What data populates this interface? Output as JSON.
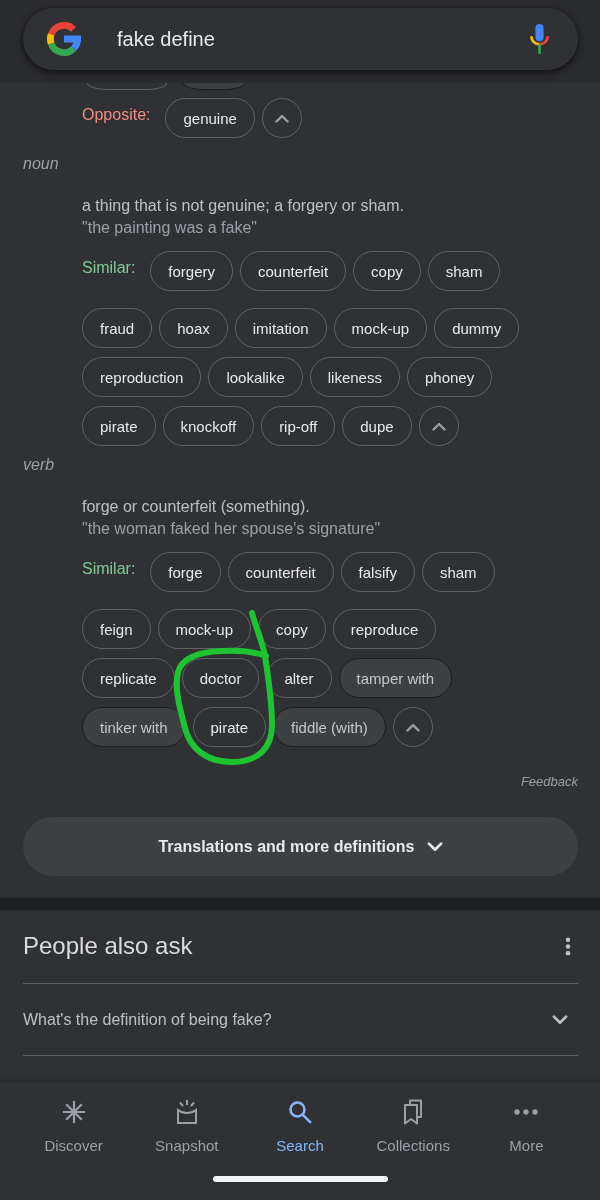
{
  "search_bar": {
    "value": "fake define"
  },
  "top_sense": {
    "covered_chips": [
      {
        "filled": false
      },
      {
        "filled": true
      }
    ],
    "opposite": {
      "label": "Opposite:",
      "chips": [
        {
          "text": "genuine",
          "filled": false
        }
      ],
      "expanded": true
    }
  },
  "senses": [
    {
      "part_of_speech": "noun",
      "definition": "a thing that is not genuine; a forgery or sham.",
      "example": "\"the painting was a fake\"",
      "similar": {
        "label": "Similar:",
        "chips": [
          {
            "text": "forgery",
            "filled": false
          },
          {
            "text": "counterfeit",
            "filled": false
          },
          {
            "text": "copy",
            "filled": false
          },
          {
            "text": "sham",
            "filled": false
          }
        ]
      },
      "more_rows": [
        {
          "chips": [
            {
              "text": "fraud",
              "filled": false
            },
            {
              "text": "hoax",
              "filled": false
            },
            {
              "text": "imitation",
              "filled": false
            },
            {
              "text": "mock-up",
              "filled": false
            },
            {
              "text": "dummy",
              "filled": false
            }
          ]
        },
        {
          "chips": [
            {
              "text": "reproduction",
              "filled": false
            },
            {
              "text": "lookalike",
              "filled": false
            },
            {
              "text": "likeness",
              "filled": false
            },
            {
              "text": "phoney",
              "filled": false
            }
          ]
        },
        {
          "chips": [
            {
              "text": "pirate",
              "filled": false
            },
            {
              "text": "knockoff",
              "filled": false
            },
            {
              "text": "rip-off",
              "filled": false
            },
            {
              "text": "dupe",
              "filled": false
            }
          ]
        }
      ],
      "expanded": true
    },
    {
      "part_of_speech": "verb",
      "definition": "forge or counterfeit (something).",
      "example": "\"the woman faked her spouse's signature\"",
      "similar": {
        "label": "Similar:",
        "chips": [
          {
            "text": "forge",
            "filled": false
          },
          {
            "text": "counterfeit",
            "filled": false
          },
          {
            "text": "falsify",
            "filled": false
          },
          {
            "text": "sham",
            "filled": false
          }
        ]
      },
      "more_rows": [
        {
          "chips": [
            {
              "text": "feign",
              "filled": false
            },
            {
              "text": "mock-up",
              "filled": false
            },
            {
              "text": "copy",
              "filled": false
            },
            {
              "text": "reproduce",
              "filled": false
            }
          ]
        },
        {
          "chips": [
            {
              "text": "replicate",
              "filled": false
            },
            {
              "text": "doctor",
              "filled": false
            },
            {
              "text": "alter",
              "filled": false
            },
            {
              "text": "tamper with",
              "filled": true
            }
          ]
        },
        {
          "chips": [
            {
              "text": "tinker with",
              "filled": true
            },
            {
              "text": "pirate",
              "filled": false
            },
            {
              "text": "fiddle (with)",
              "filled": true
            }
          ]
        }
      ],
      "expanded": true
    }
  ],
  "feedback": "Feedback",
  "more_definitions": {
    "label": "Translations and more definitions",
    "expanded": false
  },
  "people_also_ask": {
    "title": "People also ask",
    "questions": [
      {
        "text": "What's the definition of being fake?",
        "expanded": false
      }
    ]
  },
  "bottom_nav": [
    {
      "label": "Discover",
      "selected": false
    },
    {
      "label": "Snapshot",
      "selected": false
    },
    {
      "label": "Search",
      "selected": true
    },
    {
      "label": "Collections",
      "selected": false
    },
    {
      "label": "More",
      "selected": false
    }
  ]
}
